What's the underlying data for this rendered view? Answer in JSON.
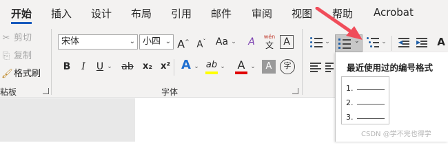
{
  "tabs": [
    {
      "label": "开始",
      "active": true
    },
    {
      "label": "插入"
    },
    {
      "label": "设计"
    },
    {
      "label": "布局"
    },
    {
      "label": "引用"
    },
    {
      "label": "邮件"
    },
    {
      "label": "审阅"
    },
    {
      "label": "视图"
    },
    {
      "label": "帮助"
    },
    {
      "label": "Acrobat"
    }
  ],
  "clipboard": {
    "cut": "剪切",
    "copy": "复制",
    "format_painter": "格式刷",
    "group_label": "粘板"
  },
  "font": {
    "font_name": "宋体",
    "font_size": "小四",
    "grow": "A",
    "shrink": "A",
    "change_case": "Aa",
    "clear_format": "A",
    "phonetic_top": "wén",
    "phonetic_bottom": "文",
    "char_border": "A",
    "bold": "B",
    "italic": "I",
    "underline": "U",
    "strikethrough": "ab",
    "subscript": "x₂",
    "superscript": "x²",
    "text_effects": "A",
    "highlight": "ab",
    "font_color": "A",
    "char_shading": "A",
    "enclose": "字",
    "group_label": "字体"
  },
  "paragraph": {
    "accent_numbering_bg": "#c7c7c7"
  },
  "numbering_panel": {
    "title": "最近使用过的编号格式",
    "items": [
      "1.",
      "2.",
      "3."
    ]
  },
  "watermark": "CSDN @学不完也得学",
  "colors": {
    "accent": "#185abd",
    "highlight": "#ffff00",
    "font_color": "#e00000",
    "text_effect": "#1f6fd0",
    "arrow": "#f04d5a"
  }
}
